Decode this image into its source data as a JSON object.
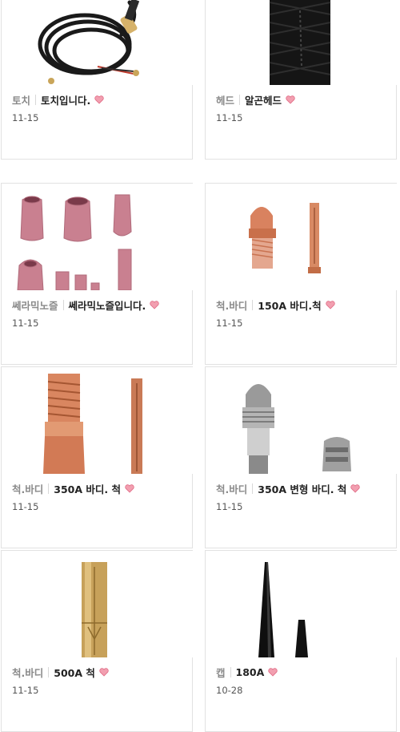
{
  "products": [
    {
      "category": "토치",
      "title": "토치입니다.",
      "date": "11-15",
      "image": "torch-cable-image"
    },
    {
      "category": "헤드",
      "title": "알곤헤드",
      "date": "11-15",
      "image": "head-sleeve-image"
    },
    {
      "category": "쎄라믹노즐",
      "title": "쎄라믹노즐입니다.",
      "date": "11-15",
      "image": "ceramic-nozzle-image"
    },
    {
      "category": "척.바디",
      "title": "150A 바디.척",
      "date": "11-15",
      "image": "collet-body-150a-image"
    },
    {
      "category": "척.바디",
      "title": "350A 바디. 척",
      "date": "11-15",
      "image": "collet-body-350a-image"
    },
    {
      "category": "척.바디",
      "title": "350A 변형 바디. 척",
      "date": "11-15",
      "image": "modified-body-350a-image"
    },
    {
      "category": "척.바디",
      "title": "500A 척",
      "date": "11-15",
      "image": "collet-500a-image"
    },
    {
      "category": "캡",
      "title": "180A",
      "date": "10-28",
      "image": "back-cap-image"
    }
  ],
  "colors": {
    "heart": "#f29fb0",
    "heart_outline": "#e06b85"
  }
}
